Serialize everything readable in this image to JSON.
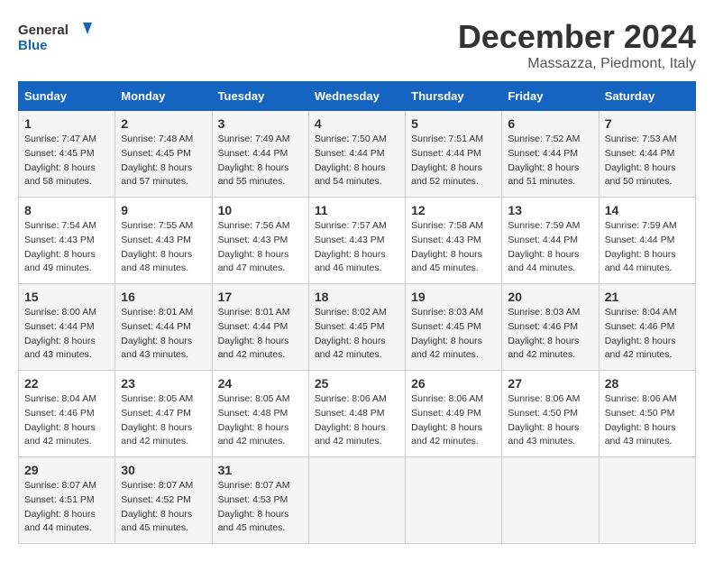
{
  "header": {
    "logo_line1": "General",
    "logo_line2": "Blue",
    "month": "December 2024",
    "location": "Massazza, Piedmont, Italy"
  },
  "weekdays": [
    "Sunday",
    "Monday",
    "Tuesday",
    "Wednesday",
    "Thursday",
    "Friday",
    "Saturday"
  ],
  "weeks": [
    [
      {
        "day": "1",
        "sunrise": "Sunrise: 7:47 AM",
        "sunset": "Sunset: 4:45 PM",
        "daylight": "Daylight: 8 hours and 58 minutes."
      },
      {
        "day": "2",
        "sunrise": "Sunrise: 7:48 AM",
        "sunset": "Sunset: 4:45 PM",
        "daylight": "Daylight: 8 hours and 57 minutes."
      },
      {
        "day": "3",
        "sunrise": "Sunrise: 7:49 AM",
        "sunset": "Sunset: 4:44 PM",
        "daylight": "Daylight: 8 hours and 55 minutes."
      },
      {
        "day": "4",
        "sunrise": "Sunrise: 7:50 AM",
        "sunset": "Sunset: 4:44 PM",
        "daylight": "Daylight: 8 hours and 54 minutes."
      },
      {
        "day": "5",
        "sunrise": "Sunrise: 7:51 AM",
        "sunset": "Sunset: 4:44 PM",
        "daylight": "Daylight: 8 hours and 52 minutes."
      },
      {
        "day": "6",
        "sunrise": "Sunrise: 7:52 AM",
        "sunset": "Sunset: 4:44 PM",
        "daylight": "Daylight: 8 hours and 51 minutes."
      },
      {
        "day": "7",
        "sunrise": "Sunrise: 7:53 AM",
        "sunset": "Sunset: 4:44 PM",
        "daylight": "Daylight: 8 hours and 50 minutes."
      }
    ],
    [
      {
        "day": "8",
        "sunrise": "Sunrise: 7:54 AM",
        "sunset": "Sunset: 4:43 PM",
        "daylight": "Daylight: 8 hours and 49 minutes."
      },
      {
        "day": "9",
        "sunrise": "Sunrise: 7:55 AM",
        "sunset": "Sunset: 4:43 PM",
        "daylight": "Daylight: 8 hours and 48 minutes."
      },
      {
        "day": "10",
        "sunrise": "Sunrise: 7:56 AM",
        "sunset": "Sunset: 4:43 PM",
        "daylight": "Daylight: 8 hours and 47 minutes."
      },
      {
        "day": "11",
        "sunrise": "Sunrise: 7:57 AM",
        "sunset": "Sunset: 4:43 PM",
        "daylight": "Daylight: 8 hours and 46 minutes."
      },
      {
        "day": "12",
        "sunrise": "Sunrise: 7:58 AM",
        "sunset": "Sunset: 4:43 PM",
        "daylight": "Daylight: 8 hours and 45 minutes."
      },
      {
        "day": "13",
        "sunrise": "Sunrise: 7:59 AM",
        "sunset": "Sunset: 4:44 PM",
        "daylight": "Daylight: 8 hours and 44 minutes."
      },
      {
        "day": "14",
        "sunrise": "Sunrise: 7:59 AM",
        "sunset": "Sunset: 4:44 PM",
        "daylight": "Daylight: 8 hours and 44 minutes."
      }
    ],
    [
      {
        "day": "15",
        "sunrise": "Sunrise: 8:00 AM",
        "sunset": "Sunset: 4:44 PM",
        "daylight": "Daylight: 8 hours and 43 minutes."
      },
      {
        "day": "16",
        "sunrise": "Sunrise: 8:01 AM",
        "sunset": "Sunset: 4:44 PM",
        "daylight": "Daylight: 8 hours and 43 minutes."
      },
      {
        "day": "17",
        "sunrise": "Sunrise: 8:01 AM",
        "sunset": "Sunset: 4:44 PM",
        "daylight": "Daylight: 8 hours and 42 minutes."
      },
      {
        "day": "18",
        "sunrise": "Sunrise: 8:02 AM",
        "sunset": "Sunset: 4:45 PM",
        "daylight": "Daylight: 8 hours and 42 minutes."
      },
      {
        "day": "19",
        "sunrise": "Sunrise: 8:03 AM",
        "sunset": "Sunset: 4:45 PM",
        "daylight": "Daylight: 8 hours and 42 minutes."
      },
      {
        "day": "20",
        "sunrise": "Sunrise: 8:03 AM",
        "sunset": "Sunset: 4:46 PM",
        "daylight": "Daylight: 8 hours and 42 minutes."
      },
      {
        "day": "21",
        "sunrise": "Sunrise: 8:04 AM",
        "sunset": "Sunset: 4:46 PM",
        "daylight": "Daylight: 8 hours and 42 minutes."
      }
    ],
    [
      {
        "day": "22",
        "sunrise": "Sunrise: 8:04 AM",
        "sunset": "Sunset: 4:46 PM",
        "daylight": "Daylight: 8 hours and 42 minutes."
      },
      {
        "day": "23",
        "sunrise": "Sunrise: 8:05 AM",
        "sunset": "Sunset: 4:47 PM",
        "daylight": "Daylight: 8 hours and 42 minutes."
      },
      {
        "day": "24",
        "sunrise": "Sunrise: 8:05 AM",
        "sunset": "Sunset: 4:48 PM",
        "daylight": "Daylight: 8 hours and 42 minutes."
      },
      {
        "day": "25",
        "sunrise": "Sunrise: 8:06 AM",
        "sunset": "Sunset: 4:48 PM",
        "daylight": "Daylight: 8 hours and 42 minutes."
      },
      {
        "day": "26",
        "sunrise": "Sunrise: 8:06 AM",
        "sunset": "Sunset: 4:49 PM",
        "daylight": "Daylight: 8 hours and 42 minutes."
      },
      {
        "day": "27",
        "sunrise": "Sunrise: 8:06 AM",
        "sunset": "Sunset: 4:50 PM",
        "daylight": "Daylight: 8 hours and 43 minutes."
      },
      {
        "day": "28",
        "sunrise": "Sunrise: 8:06 AM",
        "sunset": "Sunset: 4:50 PM",
        "daylight": "Daylight: 8 hours and 43 minutes."
      }
    ],
    [
      {
        "day": "29",
        "sunrise": "Sunrise: 8:07 AM",
        "sunset": "Sunset: 4:51 PM",
        "daylight": "Daylight: 8 hours and 44 minutes."
      },
      {
        "day": "30",
        "sunrise": "Sunrise: 8:07 AM",
        "sunset": "Sunset: 4:52 PM",
        "daylight": "Daylight: 8 hours and 45 minutes."
      },
      {
        "day": "31",
        "sunrise": "Sunrise: 8:07 AM",
        "sunset": "Sunset: 4:53 PM",
        "daylight": "Daylight: 8 hours and 45 minutes."
      },
      null,
      null,
      null,
      null
    ]
  ]
}
